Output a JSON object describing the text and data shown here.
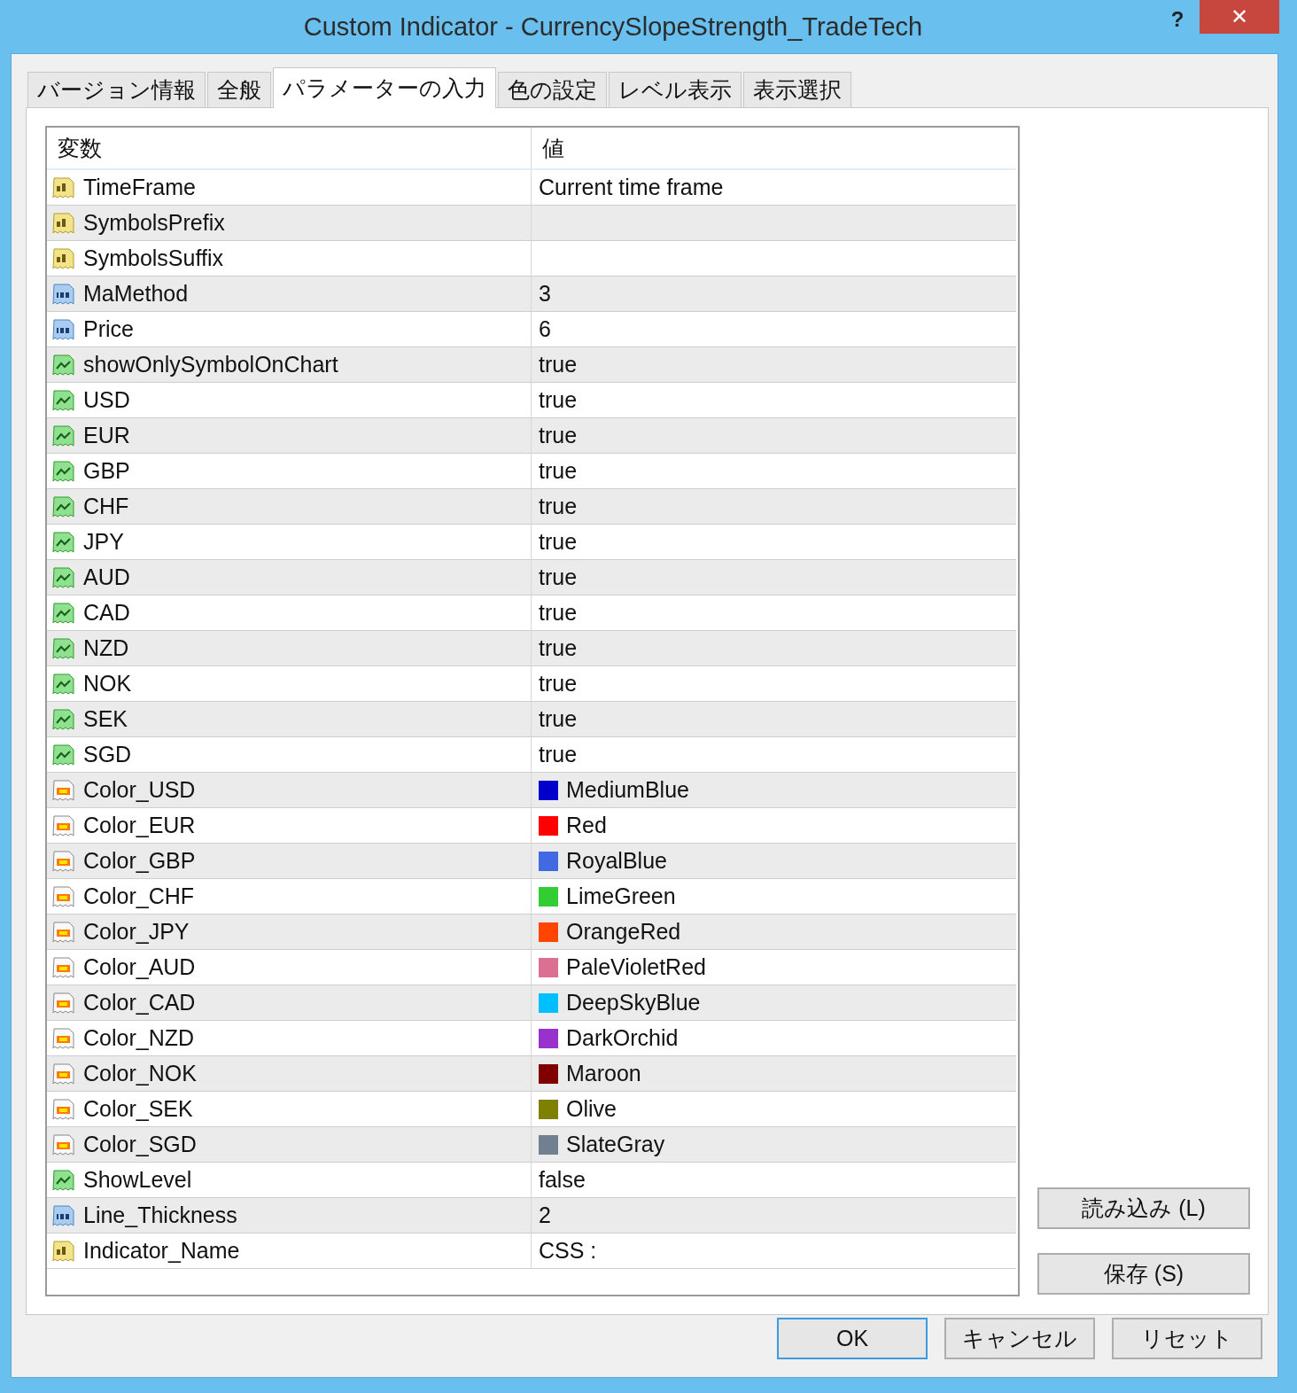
{
  "window": {
    "title": "Custom Indicator - CurrencySlopeStrength_TradeTech",
    "help_button": "?",
    "close_button": "✕"
  },
  "tabs": [
    {
      "label": "バージョン情報",
      "selected": false
    },
    {
      "label": "全般",
      "selected": false
    },
    {
      "label": "パラメーターの入力",
      "selected": true
    },
    {
      "label": "色の設定",
      "selected": false
    },
    {
      "label": "レベル表示",
      "selected": false
    },
    {
      "label": "表示選択",
      "selected": false
    }
  ],
  "table": {
    "columns": [
      "変数",
      "値"
    ],
    "rows": [
      {
        "kind": "string",
        "name": "TimeFrame",
        "value": "Current time frame"
      },
      {
        "kind": "string",
        "name": "SymbolsPrefix"
      },
      {
        "kind": "string",
        "name": "SymbolsSuffix"
      },
      {
        "kind": "int",
        "name": "MaMethod",
        "value": "3"
      },
      {
        "kind": "int",
        "name": "Price",
        "value": "6"
      },
      {
        "kind": "bool",
        "name": "showOnlySymbolOnChart",
        "value": "true"
      },
      {
        "kind": "bool",
        "name": "USD",
        "value": "true"
      },
      {
        "kind": "bool",
        "name": "EUR",
        "value": "true"
      },
      {
        "kind": "bool",
        "name": "GBP",
        "value": "true"
      },
      {
        "kind": "bool",
        "name": "CHF",
        "value": "true"
      },
      {
        "kind": "bool",
        "name": "JPY",
        "value": "true"
      },
      {
        "kind": "bool",
        "name": "AUD",
        "value": "true"
      },
      {
        "kind": "bool",
        "name": "CAD",
        "value": "true"
      },
      {
        "kind": "bool",
        "name": "NZD",
        "value": "true"
      },
      {
        "kind": "bool",
        "name": "NOK",
        "value": "true"
      },
      {
        "kind": "bool",
        "name": "SEK",
        "value": "true"
      },
      {
        "kind": "bool",
        "name": "SGD",
        "value": "true"
      },
      {
        "kind": "color",
        "name": "Color_USD",
        "value": "MediumBlue",
        "color": "#0000cd"
      },
      {
        "kind": "color",
        "name": "Color_EUR",
        "value": "Red",
        "color": "#ff0000"
      },
      {
        "kind": "color",
        "name": "Color_GBP",
        "value": "RoyalBlue",
        "color": "#4169e1"
      },
      {
        "kind": "color",
        "name": "Color_CHF",
        "value": "LimeGreen",
        "color": "#32cd32"
      },
      {
        "kind": "color",
        "name": "Color_JPY",
        "value": "OrangeRed",
        "color": "#ff4500"
      },
      {
        "kind": "color",
        "name": "Color_AUD",
        "value": "PaleVioletRed",
        "color": "#db7093"
      },
      {
        "kind": "color",
        "name": "Color_CAD",
        "value": "DeepSkyBlue",
        "color": "#00bfff"
      },
      {
        "kind": "color",
        "name": "Color_NZD",
        "value": "DarkOrchid",
        "color": "#9932cc"
      },
      {
        "kind": "color",
        "name": "Color_NOK",
        "value": "Maroon",
        "color": "#800000"
      },
      {
        "kind": "color",
        "name": "Color_SEK",
        "value": "Olive",
        "color": "#808000"
      },
      {
        "kind": "color",
        "name": "Color_SGD",
        "value": "SlateGray",
        "color": "#708090"
      },
      {
        "kind": "bool",
        "name": "ShowLevel",
        "value": "false"
      },
      {
        "kind": "int",
        "name": "Line_Thickness",
        "value": "2"
      },
      {
        "kind": "string",
        "name": "Indicator_Name",
        "value": "CSS :"
      }
    ]
  },
  "side_buttons": [
    "読み込み (L)",
    "保存 (S)"
  ],
  "buttons": [
    {
      "label": "OK",
      "default": true
    },
    {
      "label": "キャンセル",
      "default": false
    },
    {
      "label": "リセット",
      "default": false
    }
  ]
}
